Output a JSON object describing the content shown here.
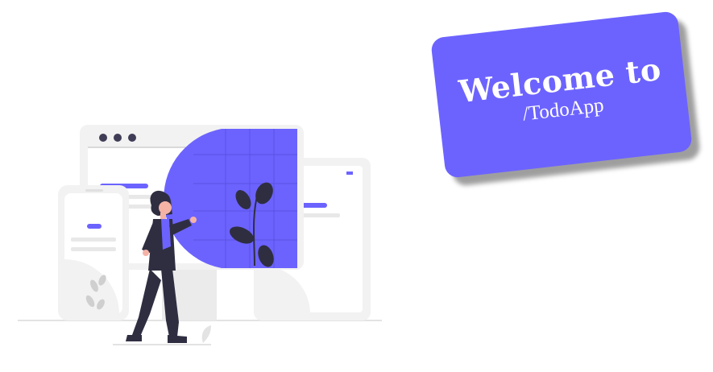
{
  "welcome": {
    "title": "Welcome to",
    "subtitle": "/TodoApp"
  },
  "illustration": {
    "name": "person presenting responsive website on devices",
    "accent_color": "#6c63ff",
    "light_gray": "#f2f2f2",
    "dark_color": "#2f2e41"
  }
}
